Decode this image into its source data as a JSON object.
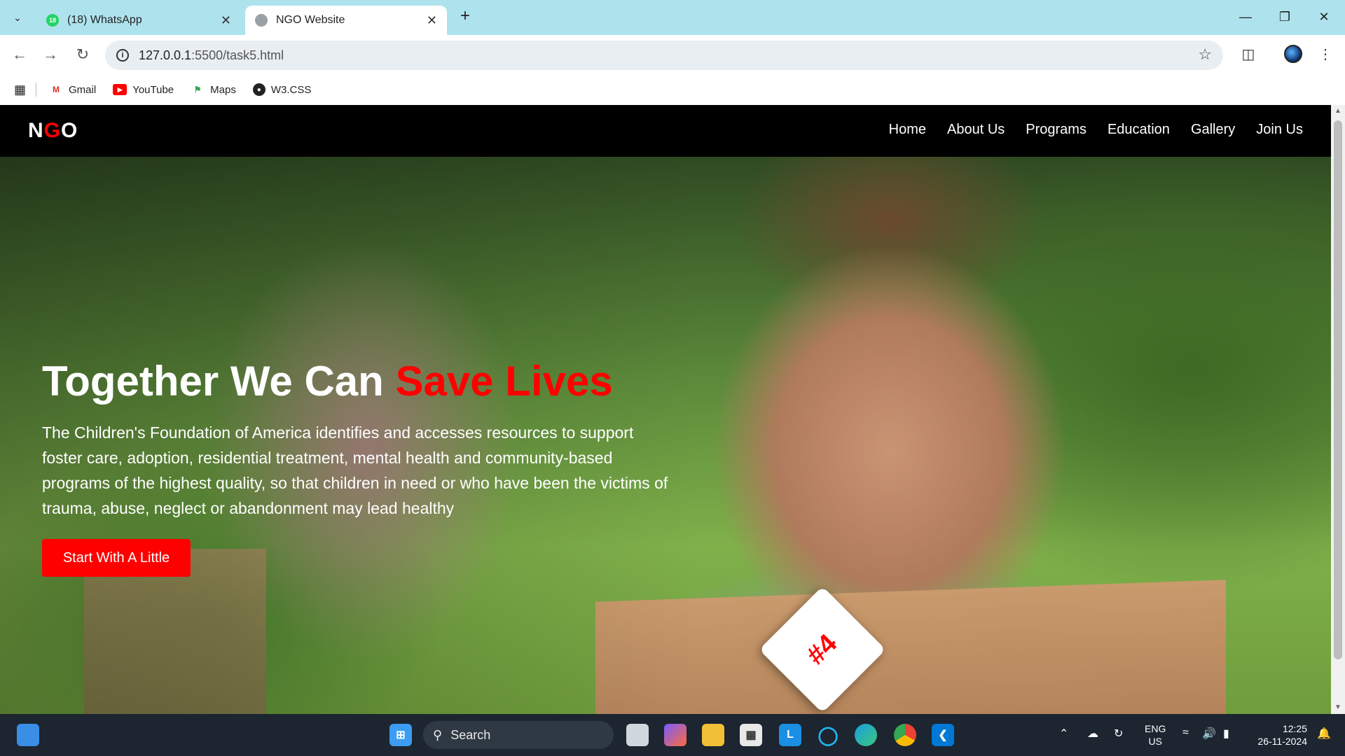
{
  "browser": {
    "tabs": [
      {
        "title": "(18) WhatsApp",
        "badge": "18",
        "active": false
      },
      {
        "title": "NGO Website",
        "active": true
      }
    ],
    "address": {
      "host": "127.0.0.1",
      "path": ":5500/task5.html"
    },
    "bookmarks": [
      {
        "label": "Gmail",
        "icon": "gmail-icon"
      },
      {
        "label": "YouTube",
        "icon": "youtube-icon"
      },
      {
        "label": "Maps",
        "icon": "maps-icon"
      },
      {
        "label": "W3.CSS",
        "icon": "globe-icon"
      }
    ]
  },
  "site": {
    "logo": {
      "part1": "N",
      "part2": "G",
      "part3": "O"
    },
    "nav": [
      "Home",
      "About Us",
      "Programs",
      "Education",
      "Gallery",
      "Join Us"
    ],
    "hero": {
      "title_main": "Together We Can ",
      "title_accent": "Save Lives",
      "text": "The Children's Foundation of America identifies and accesses resources to support foster care, adoption, residential treatment, mental health and community-based programs of the highest quality, so that children in need or who have been the victims of trauma, abuse, neglect or abandonment may lead healthy",
      "cta": "Start With A Little",
      "badge": "#4"
    },
    "colors": {
      "accent": "#ff0000",
      "nav_bg": "#000000"
    }
  },
  "taskbar": {
    "search_placeholder": "Search",
    "lang_top": "ENG",
    "lang_bottom": "US",
    "time": "12:25",
    "date": "26-11-2024"
  }
}
